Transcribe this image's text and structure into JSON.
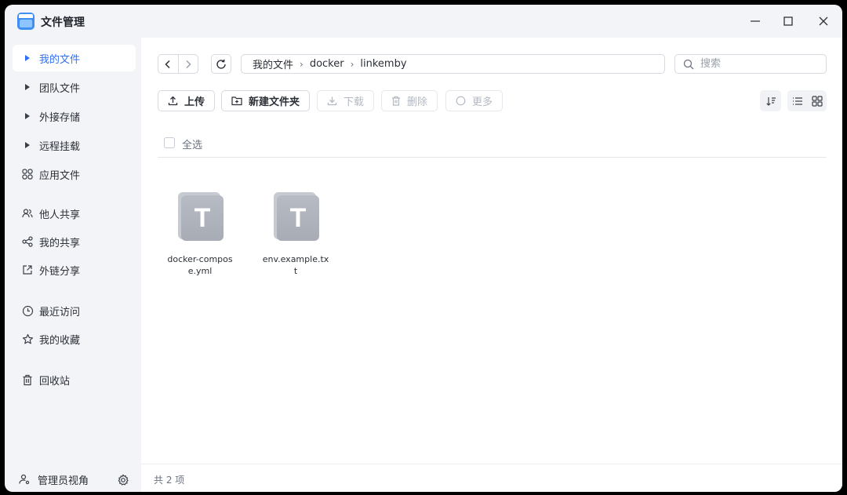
{
  "app": {
    "title": "文件管理",
    "window_controls": {
      "minimize": "—",
      "maximize": "☐",
      "close": "✕"
    }
  },
  "sidebar": {
    "items": [
      {
        "label": "我的文件",
        "icon": "caret-right-icon",
        "active": true
      },
      {
        "label": "团队文件",
        "icon": "caret-right-icon"
      },
      {
        "label": "外接存储",
        "icon": "caret-right-icon"
      },
      {
        "label": "远程挂载",
        "icon": "caret-right-icon"
      },
      {
        "label": "应用文件",
        "icon": "apps-grid-icon"
      },
      {
        "label": "他人共享",
        "icon": "users-icon"
      },
      {
        "label": "我的共享",
        "icon": "share-icon"
      },
      {
        "label": "外链分享",
        "icon": "external-link-icon"
      },
      {
        "label": "最近访问",
        "icon": "clock-icon"
      },
      {
        "label": "我的收藏",
        "icon": "star-icon"
      },
      {
        "label": "回收站",
        "icon": "trash-icon"
      }
    ],
    "footer": {
      "label": "管理员视角",
      "icon": "admin-user-icon",
      "settings_icon": "gear-icon"
    }
  },
  "pathbar": {
    "crumbs": [
      "我的文件",
      "docker",
      "linkemby"
    ],
    "separator": "›"
  },
  "search": {
    "placeholder": "搜索"
  },
  "toolbar": {
    "upload": "上传",
    "new_folder": "新建文件夹",
    "download": "下载",
    "delete": "删除",
    "more": "更多"
  },
  "select_all_label": "全选",
  "files": [
    {
      "name": "docker-compose.yml",
      "icon_letter": "T"
    },
    {
      "name": "env.example.txt",
      "icon_letter": "T"
    }
  ],
  "status": {
    "item_count": "共 2 项"
  },
  "colors": {
    "accent": "#2f6ff5",
    "sidebar_bg": "#f2f4f8",
    "disabled_text": "#b3b9c2"
  }
}
